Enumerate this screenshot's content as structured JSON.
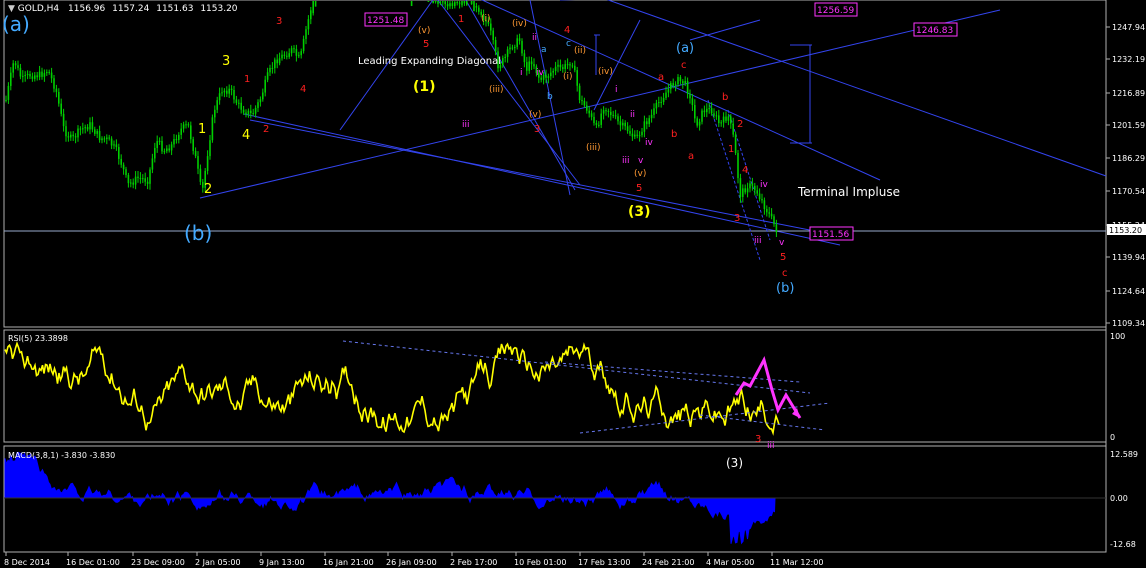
{
  "header": {
    "symbol": "GOLD,H4",
    "open": "1156.96",
    "high": "1157.24",
    "low": "1151.63",
    "close": "1153.20"
  },
  "colors": {
    "background": "#000000",
    "bull": "#00d000",
    "bear": "#00d000",
    "trendline": "#3344ee",
    "rsi": "#ffff00",
    "macd": "#0000ff",
    "annotation_magenta": "#ff33ff",
    "wave_red": "#ff2020",
    "wave_yellow": "#ffff00",
    "wave_cyan": "#44aaff",
    "wave_orange": "#ff9933",
    "bid_line": "#99aacc"
  },
  "chart_data": [
    {
      "type": "candlestick",
      "name": "price",
      "ylim": [
        1109.34,
        1262.9
      ],
      "yticks": [
        "1247.94",
        "1232.19",
        "1216.89",
        "1201.59",
        "1186.29",
        "1170.54",
        "1155.24",
        "1139.94",
        "1124.64",
        "1109.34"
      ],
      "current_price_label": "1153.20",
      "trendline_value": "1151.56",
      "annotations": {
        "price_boxes": [
          "1251.48",
          "1256.59",
          "1246.83",
          "1151.56"
        ],
        "texts": {
          "leading_diagonal": "Leading Expanding Diagonal",
          "terminal_impulse": "Terminal Impluse"
        },
        "waves": {
          "a_big": "(a)",
          "b_big": "(b)",
          "a_blue": "(a)",
          "b_blue": "(b)",
          "one": "(1)",
          "three": "(3)",
          "y2": "2",
          "y3": "3",
          "y4": "4",
          "w1": "1",
          "r1": "1",
          "r2": "2",
          "r3": "3",
          "r4": "4",
          "r5": "5",
          "ra": "a",
          "rb": "b",
          "rc": "c",
          "ri": "i",
          "rii": "ii",
          "riii": "iii",
          "riv": "iv",
          "rv": "v",
          "oi": "(i)",
          "oii": "(ii)",
          "oiii": "(iii)",
          "oiv": "(iv)",
          "ov": "(v)"
        }
      }
    },
    {
      "type": "line",
      "name": "RSI(5)",
      "label": "RSI(5) 23.3898",
      "ylim": [
        0,
        100
      ],
      "yticks": [
        "100",
        "0"
      ]
    },
    {
      "type": "bar",
      "name": "MACD(3,8,1)",
      "label": "MACD(3,8,1) -3.830 -3.830",
      "yticks": [
        "12.589",
        "0.00",
        "-12.68"
      ]
    }
  ],
  "xaxis": {
    "labels": [
      "8 Dec 2014",
      "16 Dec 01:00",
      "23 Dec 09:00",
      "2 Jan 05:00",
      "9 Jan 13:00",
      "16 Jan 21:00",
      "26 Jan 09:00",
      "2 Feb 17:00",
      "10 Feb 01:00",
      "17 Feb 13:00",
      "24 Feb 21:00",
      "4 Mar 05:00",
      "11 Mar 12:00"
    ]
  }
}
